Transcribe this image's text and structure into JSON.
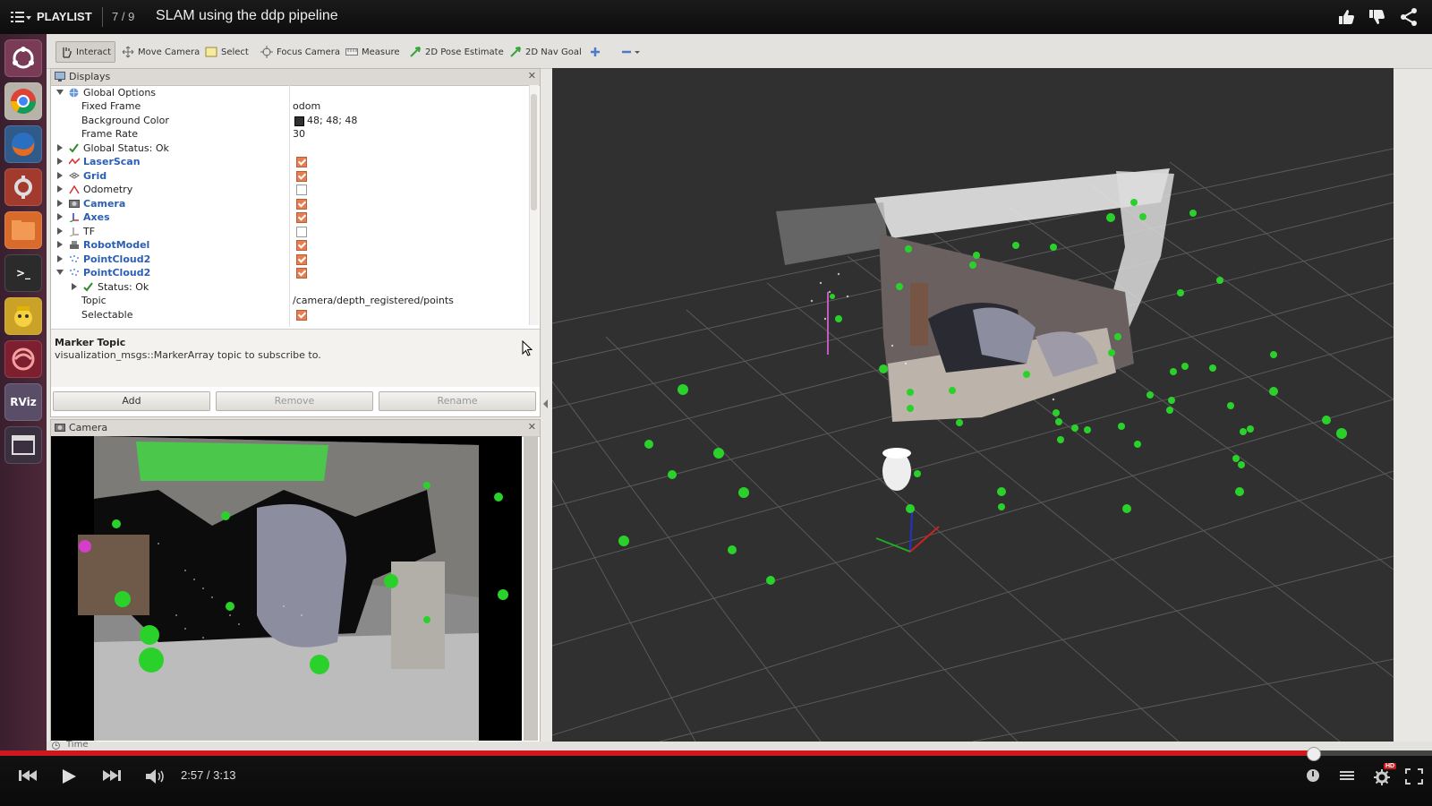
{
  "youtube": {
    "playlist_label": "PLAYLIST",
    "playlist_position": "7 / 9",
    "video_title": "SLAM using the ddp pipeline",
    "time_current": "2:57",
    "time_total": "3:13",
    "time_display": "2:57 / 3:13",
    "progress": 0.917,
    "hd_badge": "HD"
  },
  "launcher": {
    "items": [
      {
        "icon": "ubuntu-dash-icon"
      },
      {
        "icon": "chrome-icon"
      },
      {
        "icon": "firefox-icon"
      },
      {
        "icon": "system-settings-icon"
      },
      {
        "icon": "files-icon"
      },
      {
        "icon": "terminal-icon",
        "label": ">_"
      },
      {
        "icon": "robot-app-icon"
      },
      {
        "icon": "gazebo-icon"
      },
      {
        "icon": "rviz-icon",
        "label": "RViz"
      },
      {
        "icon": "window-icon"
      }
    ]
  },
  "toolbar": {
    "interact": "Interact",
    "move_camera": "Move Camera",
    "select": "Select",
    "focus_camera": "Focus Camera",
    "measure": "Measure",
    "pose_estimate": "2D Pose Estimate",
    "nav_goal": "2D Nav Goal"
  },
  "displays": {
    "title": "Displays",
    "global_options": "Global Options",
    "fixed_frame_label": "Fixed Frame",
    "fixed_frame_value": "odom",
    "bg_color_label": "Background Color",
    "bg_color_value": "48; 48; 48",
    "frame_rate_label": "Frame Rate",
    "frame_rate_value": "30",
    "global_status": "Global Status: Ok",
    "items": [
      {
        "label": "LaserScan",
        "checked": true,
        "highlight": true
      },
      {
        "label": "Grid",
        "checked": true,
        "highlight": true
      },
      {
        "label": "Odometry",
        "checked": false,
        "highlight": false
      },
      {
        "label": "Camera",
        "checked": true,
        "highlight": true
      },
      {
        "label": "Axes",
        "checked": true,
        "highlight": true
      },
      {
        "label": "TF",
        "checked": false,
        "highlight": false
      },
      {
        "label": "RobotModel",
        "checked": true,
        "highlight": true
      },
      {
        "label": "PointCloud2",
        "checked": true,
        "highlight": true
      },
      {
        "label": "PointCloud2",
        "checked": true,
        "highlight": true
      }
    ],
    "status_ok": "Status: Ok",
    "topic_label": "Topic",
    "topic_value": "/camera/depth_registered/points",
    "selectable_label": "Selectable",
    "selectable_checked": true,
    "desc_heading": "Marker Topic",
    "desc_text": "visualization_msgs::MarkerArray topic to subscribe to.",
    "add": "Add",
    "remove": "Remove",
    "rename": "Rename"
  },
  "camera_panel": {
    "title": "Camera"
  },
  "time_panel": {
    "title": "Time"
  },
  "colors": {
    "background_3d": "#303030",
    "marker_green": "#2bd12b",
    "progress_red": "#cc181e",
    "launcher": "#4d2838"
  }
}
